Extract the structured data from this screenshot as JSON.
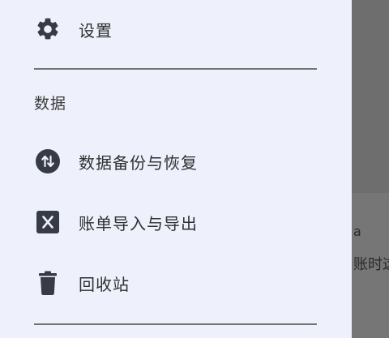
{
  "drawer": {
    "settings_label": "设置",
    "section_data_title": "数据",
    "items": [
      {
        "label": "数据备份与恢复",
        "icon": "sync-circle-icon"
      },
      {
        "label": "账单导入与导出",
        "icon": "excel-icon"
      },
      {
        "label": "回收站",
        "icon": "trash-icon"
      }
    ]
  },
  "background": {
    "visible_fragment": "账时这",
    "small_fragment": "a"
  },
  "colors": {
    "drawer_bg": "#eef1fb",
    "icon": "#363b47",
    "divider": "#737373",
    "scrim": "#6e6e6e"
  }
}
